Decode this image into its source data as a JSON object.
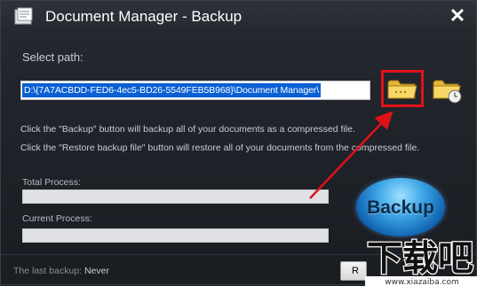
{
  "window": {
    "title": "Document Manager - Backup",
    "close_glyph": "✕"
  },
  "path": {
    "label": "Select path:",
    "value": "D:\\{7A7ACBDD-FED6-4ec5-BD26-5549FEB5B968}\\Document Manager\\"
  },
  "info": {
    "line1": "Click the \"Backup\" button will backup all of your documents as a  compressed file.",
    "line2": "Click the \"Restore backup file\" button will restore all of your documents from the compressed file."
  },
  "progress": {
    "total_label": "Total Process:",
    "total_value": 0,
    "current_label": "Current Process:",
    "current_value": 0
  },
  "buttons": {
    "backup_label": "Backup",
    "restore_partial": "R"
  },
  "footer": {
    "last_backup_label": "The last backup:",
    "last_backup_value": "Never"
  },
  "watermark": {
    "brand": "下载吧",
    "url": "www.xiazaiba.com"
  },
  "icons": {
    "app": "document-manager-app-icon",
    "browse": "folder-open-icon",
    "restore": "folder-clock-icon",
    "close": "close-icon"
  },
  "colors": {
    "annotation_red": "#e01218",
    "selection_blue": "#0a5fd3",
    "backup_blue": "#3fa8e8"
  }
}
